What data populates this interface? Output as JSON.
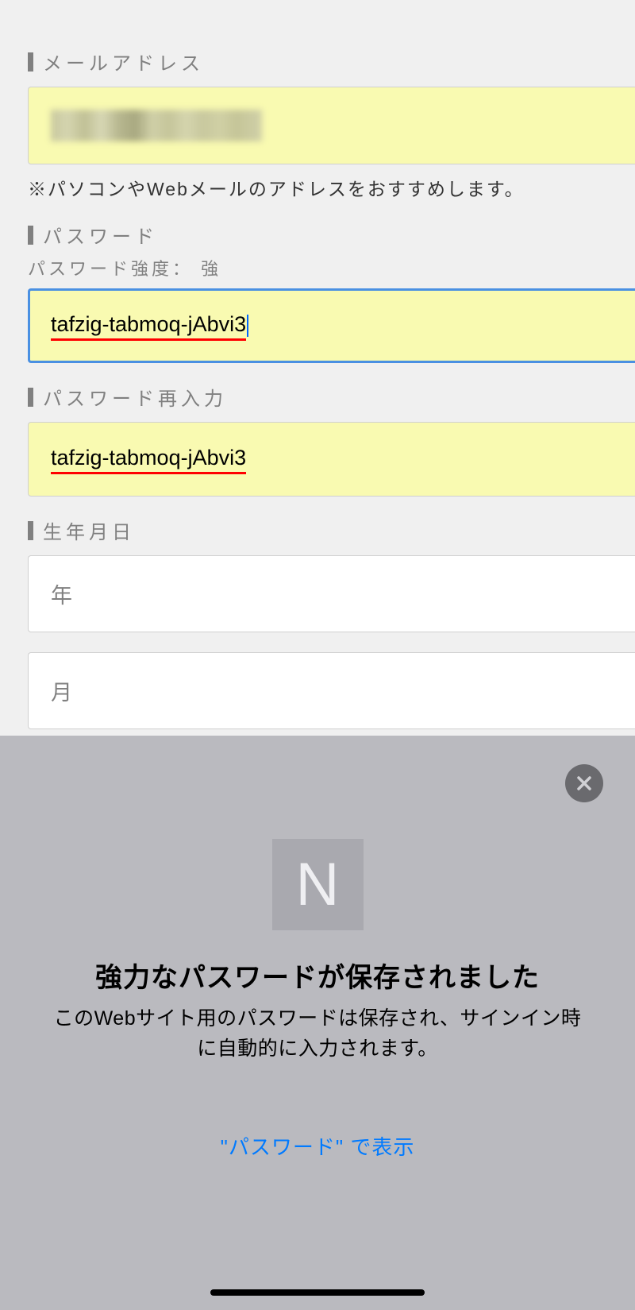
{
  "form": {
    "email": {
      "label": "メールアドレス",
      "helper": "※パソコンやWebメールのアドレスをおすすめします。"
    },
    "password": {
      "label": "パスワード",
      "strength_label": "パスワード強度： 強",
      "value": "tafzig-tabmoq-jAbvi3"
    },
    "password_confirm": {
      "label": "パスワード再入力",
      "value": "tafzig-tabmoq-jAbvi3"
    },
    "birthdate": {
      "label": "生年月日",
      "year_placeholder": "年",
      "month_placeholder": "月"
    }
  },
  "popup": {
    "icon_letter": "N",
    "title": "強力なパスワードが保存されました",
    "description": "このWebサイト用のパスワードは保存され、サインイン時に自動的に入力されます。",
    "link": "\"パスワード\" で表示"
  }
}
